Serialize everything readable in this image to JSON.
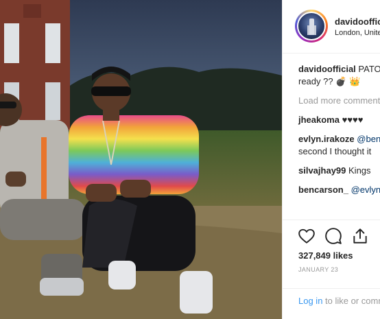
{
  "post": {
    "username": "davidoofficial",
    "location": "London, United Kingdom",
    "caption_user": "davidoofficial",
    "caption_text": "PATORANKING",
    "caption_text2": "ready ?? 💣 👑",
    "load_more": "Load more comments",
    "comments": [
      {
        "user": "jheakoma",
        "text": "♥♥♥♥",
        "text2": ""
      },
      {
        "user": "evlyn.irakoze",
        "mention": "@bencarson_",
        "text2": "second I thought it"
      },
      {
        "user": "silvajhay99",
        "text": "Kings",
        "text2": ""
      },
      {
        "user": "bencarson_",
        "mention": "@evlyn.irakoze",
        "text2": ""
      }
    ],
    "likes": "327,849 likes",
    "date": "JANUARY 23",
    "login_link": "Log in",
    "login_rest": "to like or comment."
  },
  "icons": {
    "like": "heart-icon",
    "comment": "comment-bubble-icon",
    "share": "share-icon"
  },
  "colors": {
    "accent_blue": "#3897f0",
    "mention_blue": "#003569",
    "muted": "#999999",
    "text": "#262626"
  }
}
